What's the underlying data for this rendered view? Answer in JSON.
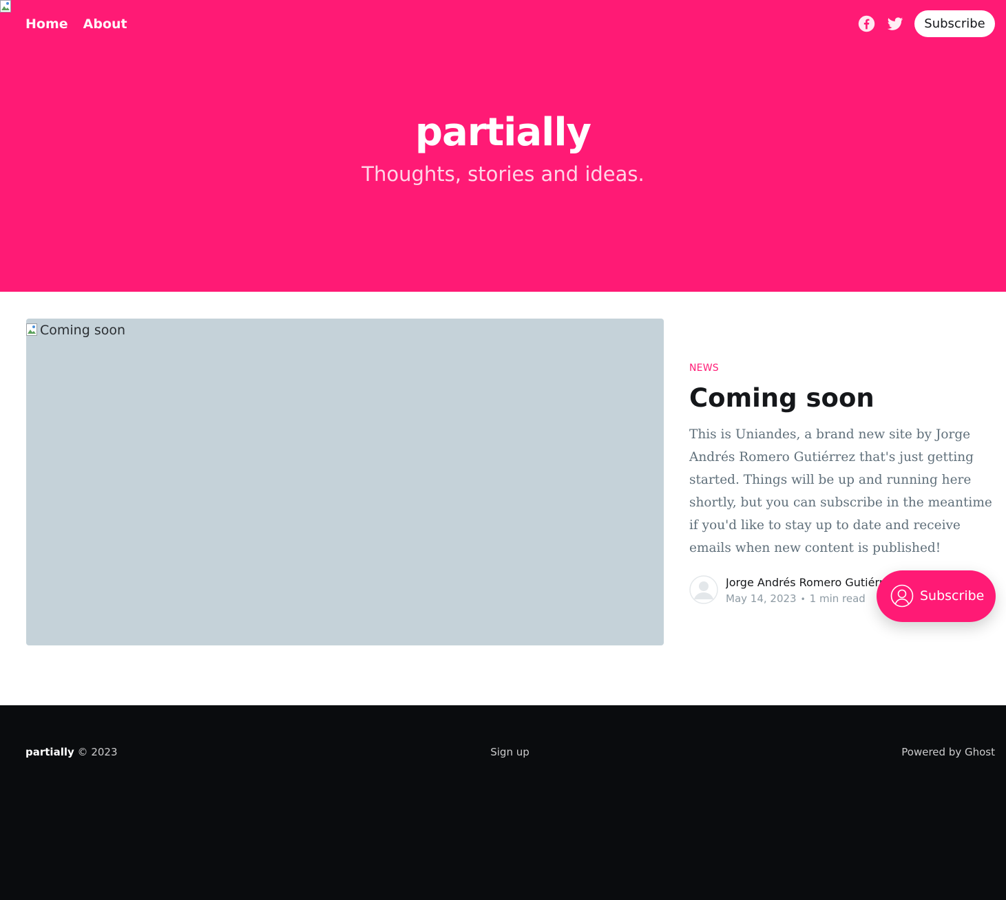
{
  "colors": {
    "accent": "#FF1A75",
    "footer_bg": "#0a0c0e",
    "image_placeholder": "#C5D2D9"
  },
  "header": {
    "nav": [
      {
        "label": "Home"
      },
      {
        "label": "About"
      }
    ],
    "social_icons": [
      "facebook-icon",
      "twitter-icon"
    ],
    "subscribe_label": "Subscribe"
  },
  "hero": {
    "title": "partially",
    "description": "Thoughts, stories and ideas."
  },
  "feature_post": {
    "image_alt": "Coming soon",
    "tag": "NEWS",
    "title": "Coming soon",
    "excerpt": "This is Uniandes, a brand new site by Jorge Andrés Romero Gutiérrez that's just getting started. Things will be up and running here shortly, but you can subscribe in the meantime if you'd like to stay up to date and receive emails when new content is published!",
    "author": "Jorge Andrés Romero Gutiérrez",
    "date": "May 14, 2023",
    "reading_time": "1 min read"
  },
  "portal": {
    "label": "Subscribe",
    "icon": "user-circle-icon"
  },
  "footer": {
    "brand": "partially",
    "copyright": "© 2023",
    "center_link": "Sign up",
    "powered_by": "Powered by Ghost"
  }
}
